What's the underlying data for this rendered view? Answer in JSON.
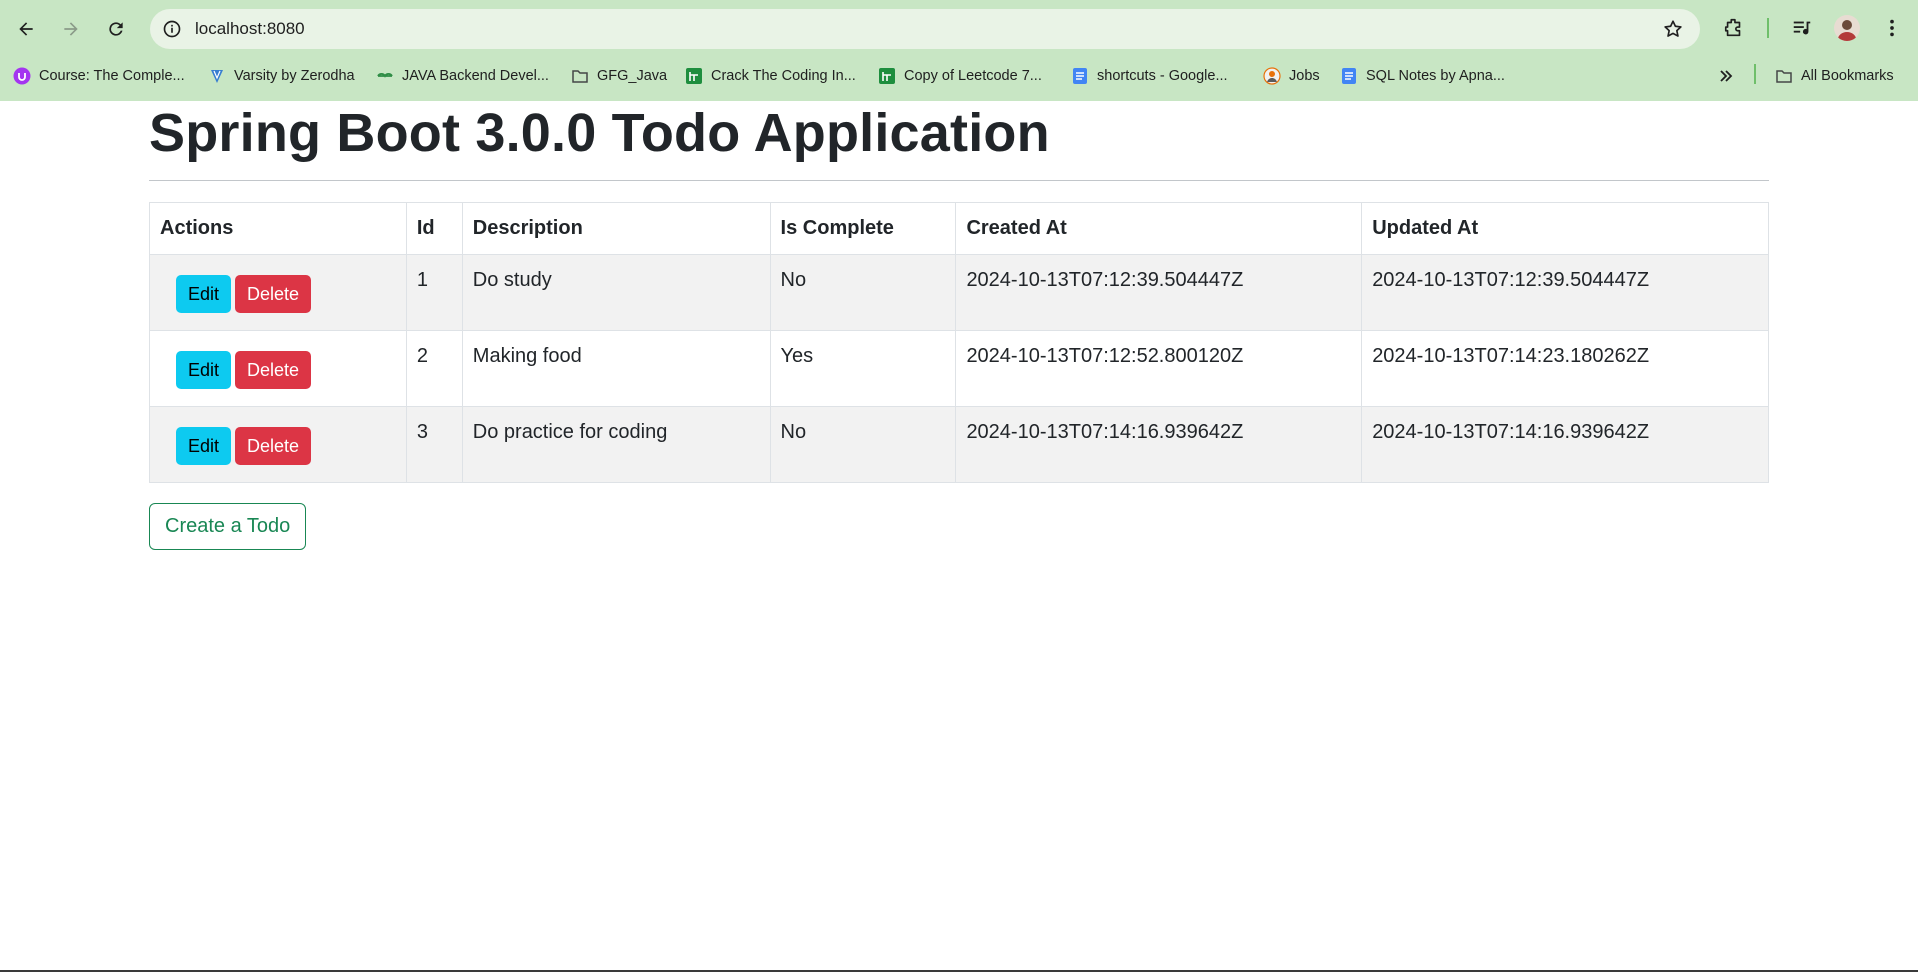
{
  "browser": {
    "url": "localhost:8080",
    "bookmarks": [
      {
        "label": "Course: The Comple...",
        "icon": "udemy-icon",
        "color": "#a435f0"
      },
      {
        "label": "Varsity by Zerodha",
        "icon": "varsity-icon",
        "color": "#387ed1"
      },
      {
        "label": "JAVA Backend Devel...",
        "icon": "gfg-icon",
        "color": "#2f8d46"
      },
      {
        "label": "GFG_Java",
        "icon": "folder-icon",
        "color": "#444746"
      },
      {
        "label": "Crack The Coding In...",
        "icon": "sheets-icon",
        "color": "#1e8e3e"
      },
      {
        "label": "Copy of Leetcode 7...",
        "icon": "sheets-icon",
        "color": "#1e8e3e"
      },
      {
        "label": "shortcuts - Google...",
        "icon": "docs-icon",
        "color": "#4285f4"
      },
      {
        "label": "Jobs",
        "icon": "jobs-icon",
        "color": "#e8710a"
      },
      {
        "label": "SQL Notes by Apna...",
        "icon": "docs-icon",
        "color": "#4285f4"
      }
    ],
    "all_bookmarks_label": "All Bookmarks"
  },
  "page": {
    "title": "Spring Boot 3.0.0 Todo Application",
    "table": {
      "headers": [
        "Actions",
        "Id",
        "Description",
        "Is Complete",
        "Created At",
        "Updated At"
      ],
      "rows": [
        {
          "id": "1",
          "description": "Do study",
          "complete": "No",
          "created": "2024-10-13T07:12:39.504447Z",
          "updated": "2024-10-13T07:12:39.504447Z"
        },
        {
          "id": "2",
          "description": "Making food",
          "complete": "Yes",
          "created": "2024-10-13T07:12:52.800120Z",
          "updated": "2024-10-13T07:14:23.180262Z"
        },
        {
          "id": "3",
          "description": "Do practice for coding",
          "complete": "No",
          "created": "2024-10-13T07:14:16.939642Z",
          "updated": "2024-10-13T07:14:16.939642Z"
        }
      ],
      "edit_label": "Edit",
      "delete_label": "Delete"
    },
    "create_label": "Create a Todo"
  },
  "colors": {
    "chrome_bg": "#c8e6c4",
    "edit_button": "#0dcaf0",
    "delete_button": "#dc3545",
    "create_outline": "#198754"
  }
}
